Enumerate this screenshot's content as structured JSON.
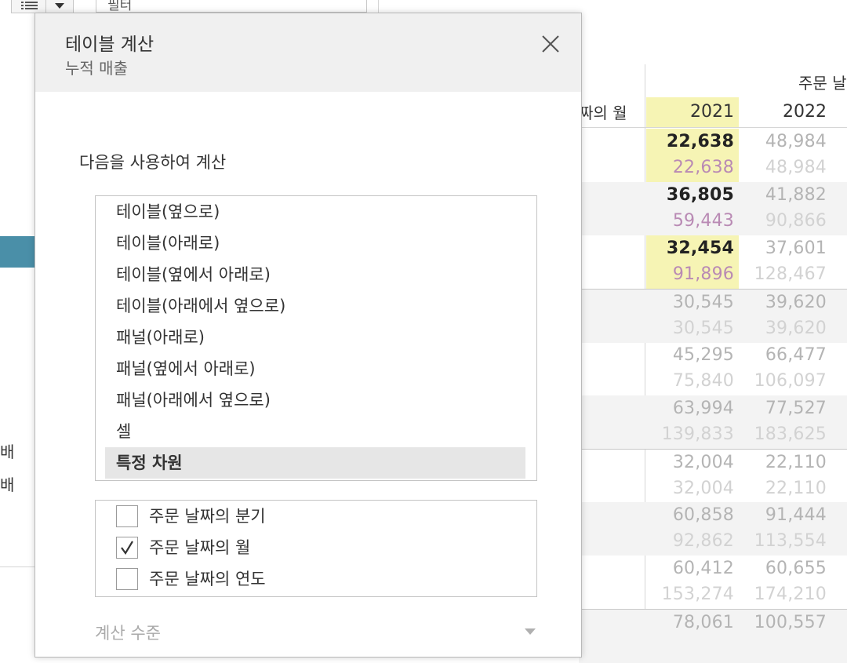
{
  "filter_card": {
    "label": "필터"
  },
  "dialog": {
    "title": "테이블 계산",
    "subtitle": "누적 매출",
    "compute_using_label": "다음을 사용하여 계산",
    "compute_options": [
      "테이블(옆으로)",
      "테이블(아래로)",
      "테이블(옆에서 아래로)",
      "테이블(아래에서 옆으로)",
      "패널(아래로)",
      "패널(옆에서 아래로)",
      "패널(아래에서 옆으로)",
      "셀",
      "특정 차원"
    ],
    "selected_option": "특정 차원",
    "dimensions": [
      {
        "label": "주문 날짜의 분기",
        "checked": false
      },
      {
        "label": "주문 날짜의 월",
        "checked": true
      },
      {
        "label": "주문 날짜의 연도",
        "checked": false
      }
    ],
    "level_label": "계산 수준"
  },
  "side_panel": {
    "labels": [
      "배",
      "배"
    ]
  },
  "table": {
    "column_header": "주문 날",
    "row_header": "짜의 월",
    "years": [
      "2021",
      "2022"
    ],
    "rows": [
      {
        "sales": [
          "22,638",
          "48,984"
        ],
        "running": [
          "22,638",
          "48,984"
        ]
      },
      {
        "sales": [
          "36,805",
          "41,882"
        ],
        "running": [
          "59,443",
          "90,866"
        ]
      },
      {
        "sales": [
          "32,454",
          "37,601"
        ],
        "running": [
          "91,896",
          "128,467"
        ]
      },
      {
        "sales": [
          "30,545",
          "39,620"
        ],
        "running": [
          "30,545",
          "39,620"
        ]
      },
      {
        "sales": [
          "45,295",
          "66,477"
        ],
        "running": [
          "75,840",
          "106,097"
        ]
      },
      {
        "sales": [
          "63,994",
          "77,527"
        ],
        "running": [
          "139,833",
          "183,625"
        ]
      },
      {
        "sales": [
          "32,004",
          "22,110"
        ],
        "running": [
          "32,004",
          "22,110"
        ]
      },
      {
        "sales": [
          "60,858",
          "91,444"
        ],
        "running": [
          "92,862",
          "113,554"
        ]
      },
      {
        "sales": [
          "60,412",
          "60,655"
        ],
        "running": [
          "153,274",
          "174,210"
        ]
      },
      {
        "sales": [
          "78,061",
          "100,557"
        ],
        "running": [
          "",
          ""
        ]
      }
    ],
    "colors": {
      "highlight": "#f6f4b4",
      "active_sales": "#222222",
      "active_running": "#b98ab4",
      "dim_sales": "#b4b4b4",
      "dim_running": "#d2d2d2",
      "running_2022_first_quarter": "#cfcfcf"
    }
  }
}
